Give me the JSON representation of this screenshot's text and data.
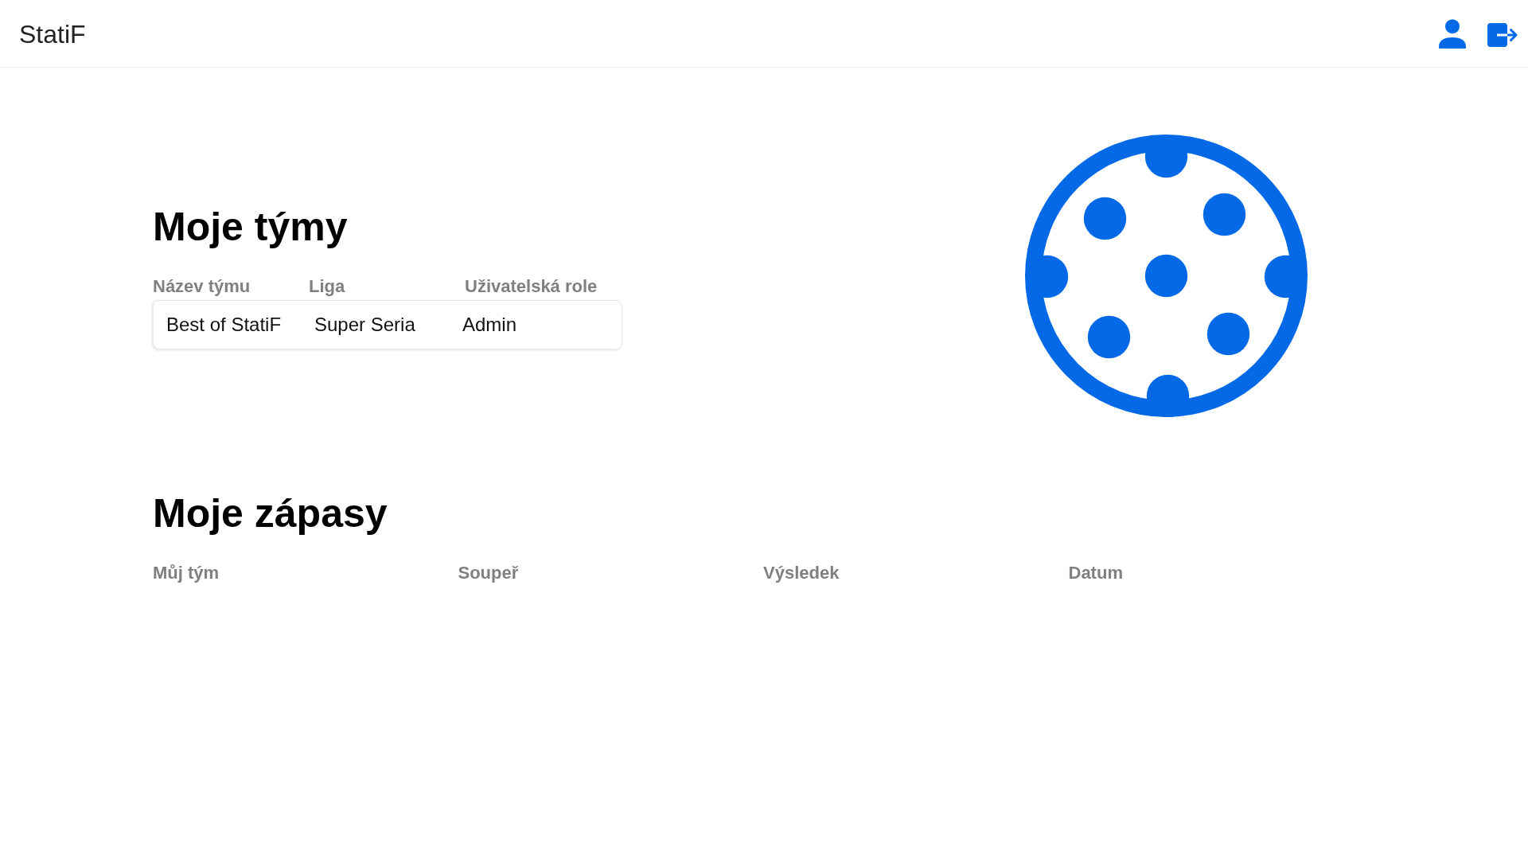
{
  "header": {
    "title": "StatiF"
  },
  "teams": {
    "title": "Moje týmy",
    "columns": [
      "Název týmu",
      "Liga",
      "Uživatelská role"
    ],
    "rows": [
      {
        "cells": [
          "Best of StatiF",
          "Super Seria",
          "Admin"
        ]
      }
    ]
  },
  "matches": {
    "title": "Moje zápasy",
    "columns": [
      "Můj tým",
      "Soupeř",
      "Výsledek",
      "Datum"
    ]
  }
}
